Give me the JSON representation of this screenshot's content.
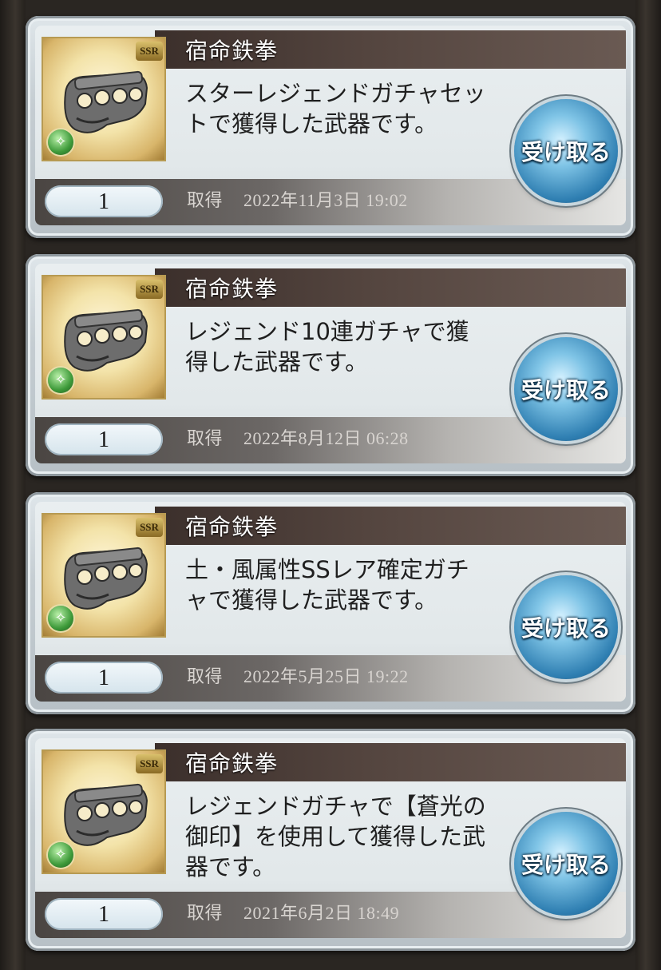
{
  "items": [
    {
      "name": "宿命鉄拳",
      "rarity": "SSR",
      "element_icon": "wind-element-icon",
      "description": "スターレジェンドガチャセットで獲得した武器です。",
      "quantity": "1",
      "acquired_label": "取得",
      "acquired_date": "2022年11月3日 19:02",
      "receive_label": "受け取る"
    },
    {
      "name": "宿命鉄拳",
      "rarity": "SSR",
      "element_icon": "wind-element-icon",
      "description": "レジェンド10連ガチャで獲得した武器です。",
      "quantity": "1",
      "acquired_label": "取得",
      "acquired_date": "2022年8月12日 06:28",
      "receive_label": "受け取る"
    },
    {
      "name": "宿命鉄拳",
      "rarity": "SSR",
      "element_icon": "wind-element-icon",
      "description": "土・風属性SSレア確定ガチャで獲得した武器です。",
      "quantity": "1",
      "acquired_label": "取得",
      "acquired_date": "2022年5月25日 19:22",
      "receive_label": "受け取る"
    },
    {
      "name": "宿命鉄拳",
      "rarity": "SSR",
      "element_icon": "wind-element-icon",
      "description": "レジェンドガチャで【蒼光の御印】を使用して獲得した武器です。",
      "quantity": "1",
      "acquired_label": "取得",
      "acquired_date": "2021年6月2日 18:49",
      "receive_label": "受け取る"
    }
  ]
}
